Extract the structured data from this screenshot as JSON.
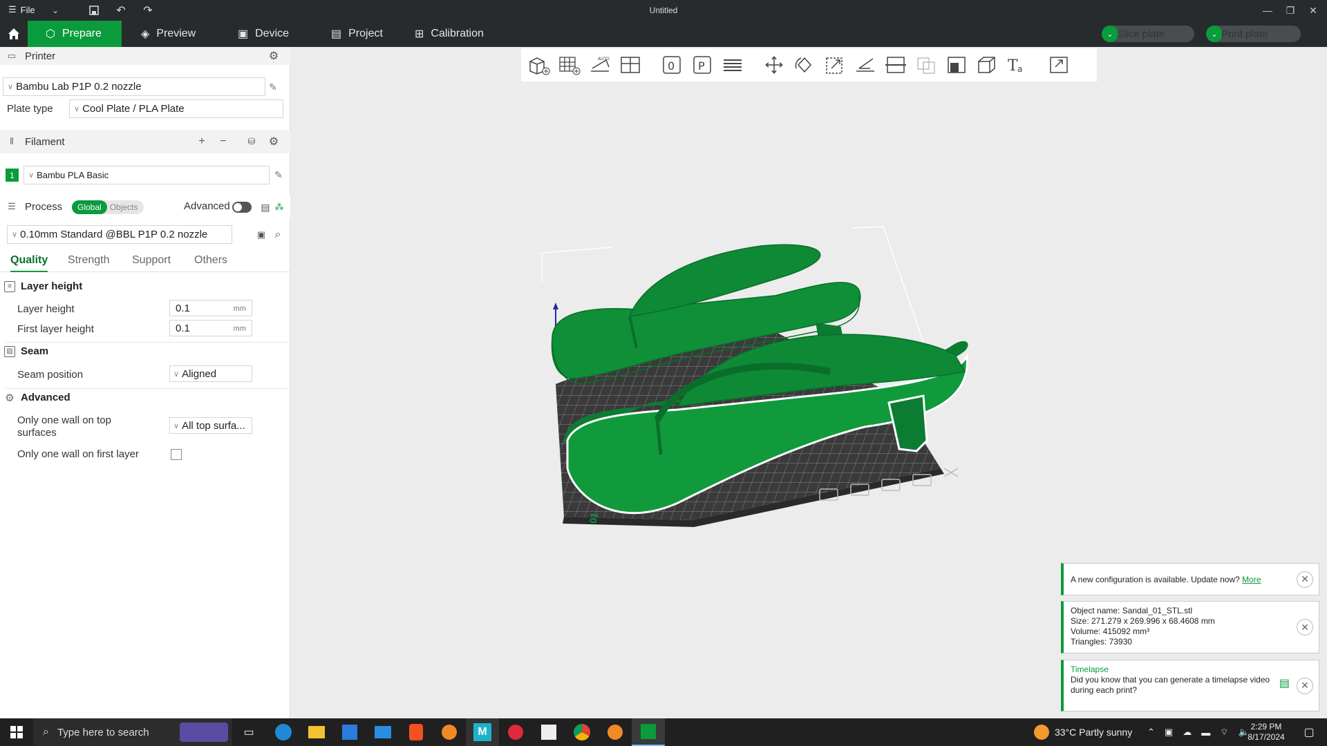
{
  "app": {
    "title": "Untitled",
    "file_label": "File"
  },
  "tabs": [
    {
      "label": "Prepare",
      "icon": "cube-icon",
      "active": true
    },
    {
      "label": "Preview",
      "icon": "layers-icon",
      "active": false
    },
    {
      "label": "Device",
      "icon": "device-icon",
      "active": false
    },
    {
      "label": "Project",
      "icon": "project-icon",
      "active": false
    },
    {
      "label": "Calibration",
      "icon": "calibration-icon",
      "active": false
    }
  ],
  "actions": {
    "slice": "Slice plate",
    "print": "Print plate"
  },
  "printer": {
    "section": "Printer",
    "name": "Bambu Lab P1P 0.2 nozzle",
    "plate_type_label": "Plate type",
    "plate_type": "Cool Plate / PLA Plate"
  },
  "filament": {
    "section": "Filament",
    "items": [
      {
        "index": "1",
        "name": "Bambu PLA Basic",
        "color": "#0a9b3c"
      }
    ]
  },
  "process": {
    "section": "Process",
    "global_label": "Global",
    "objects_label": "Objects",
    "advanced_label": "Advanced",
    "advanced_enabled": false,
    "profile": "0.10mm Standard @BBL P1P 0.2 nozzle",
    "tabs": [
      "Quality",
      "Strength",
      "Support",
      "Others"
    ],
    "active_tab": "Quality"
  },
  "quality": {
    "layer_height_group": "Layer height",
    "layer_height_label": "Layer height",
    "layer_height": "0.1",
    "first_layer_height_label": "First layer height",
    "first_layer_height": "0.1",
    "unit": "mm",
    "seam_group": "Seam",
    "seam_position_label": "Seam position",
    "seam_position": "Aligned",
    "advanced_group": "Advanced",
    "one_wall_top_label": "Only one wall on top surfaces",
    "one_wall_top": "All top surfa...",
    "one_wall_first_label": "Only one wall on first layer",
    "one_wall_first": false
  },
  "notifications": {
    "config": {
      "text": "A new configuration is available. Update now?",
      "link": "More"
    },
    "object": {
      "name": "Object name: Sandal_01_STL.stl",
      "size": "Size: 271.279 x 269.996 x 68.4608 mm",
      "volume": "Volume: 415092 mm³",
      "triangles": "Triangles: 73930"
    },
    "timelapse": {
      "title": "Timelapse",
      "text": "Did you know that you can generate a timelapse video during each print?"
    }
  },
  "plate": {
    "label": "01",
    "model_color": "#0c8a34"
  },
  "taskbar": {
    "search_placeholder": "Type here to search",
    "weather": "33°C  Partly sunny",
    "time": "2:29 PM",
    "date": "8/17/2024",
    "apps": [
      "task-view-icon",
      "edge-icon",
      "file-explorer-icon",
      "store-icon",
      "mail-icon",
      "brave-icon",
      "blender-icon",
      "app-m-icon",
      "app-heart-icon",
      "inkscape-icon",
      "chrome-icon",
      "blender-icon-2",
      "bambu-studio-icon"
    ]
  },
  "colors": {
    "accent": "#0a9b3c",
    "titlebar": "#272b2e"
  }
}
